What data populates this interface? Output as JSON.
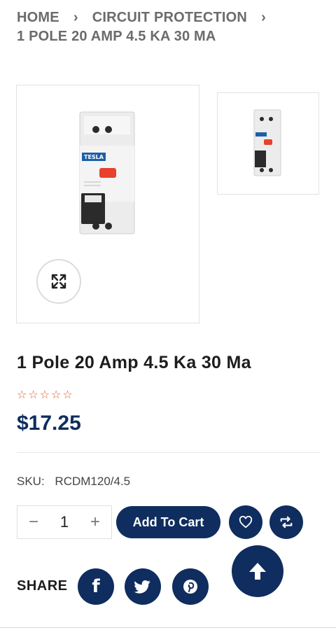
{
  "breadcrumb": {
    "home": "HOME",
    "category": "CIRCUIT PROTECTION",
    "current": "1 POLE 20 AMP 4.5 KA 30 MA",
    "separator": "›"
  },
  "product": {
    "title": "1 Pole 20 Amp 4.5 Ka 30 Ma",
    "rating": 0,
    "max_rating": 5,
    "price": "$17.25",
    "sku_label": "SKU:",
    "sku_value": "RCDM120/4.5",
    "device_brand": "TESLA"
  },
  "cart": {
    "quantity": "1",
    "minus": "−",
    "plus": "+",
    "add_label": "Add To Cart"
  },
  "share": {
    "label": "SHARE",
    "facebook": "f"
  },
  "icons": {
    "zoom": "expand-icon",
    "wishlist": "heart-icon",
    "compare": "compare-icon",
    "scroll_top": "arrow-up-icon",
    "twitter": "twitter-icon",
    "pinterest": "pinterest-icon"
  },
  "colors": {
    "primary": "#0f2d5e",
    "star": "#e35a1c",
    "breaker_red": "#e8412c"
  }
}
